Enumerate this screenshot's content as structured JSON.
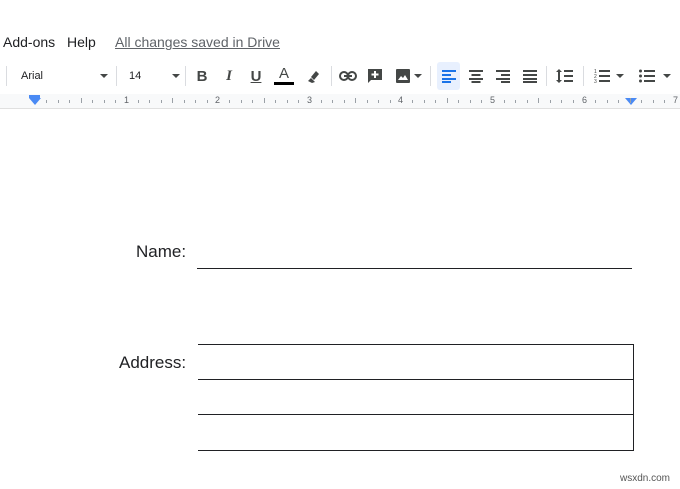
{
  "menu": {
    "addons": "Add-ons",
    "help": "Help",
    "save_status": "All changes saved in Drive"
  },
  "toolbar": {
    "font_family": "Arial",
    "font_size": "14",
    "bold": "B",
    "italic": "I",
    "underline": "U",
    "text_color": "A",
    "text_color_value": "#000000",
    "icons": [
      "highlighter-icon",
      "link-icon",
      "comment-icon",
      "image-icon",
      "align-left-icon",
      "align-center-icon",
      "align-right-icon",
      "justify-icon",
      "line-spacing-icon",
      "numbered-list-icon",
      "bulleted-list-icon"
    ]
  },
  "ruler": {
    "numbers": [
      "1",
      "2",
      "3",
      "4",
      "5",
      "6",
      "7"
    ]
  },
  "document": {
    "name_label": "Name:",
    "address_label": "Address:"
  },
  "watermark": "wsxdn.com",
  "colors": {
    "accent": "#4a8af4",
    "active_button_bg": "#e8f0fe"
  }
}
